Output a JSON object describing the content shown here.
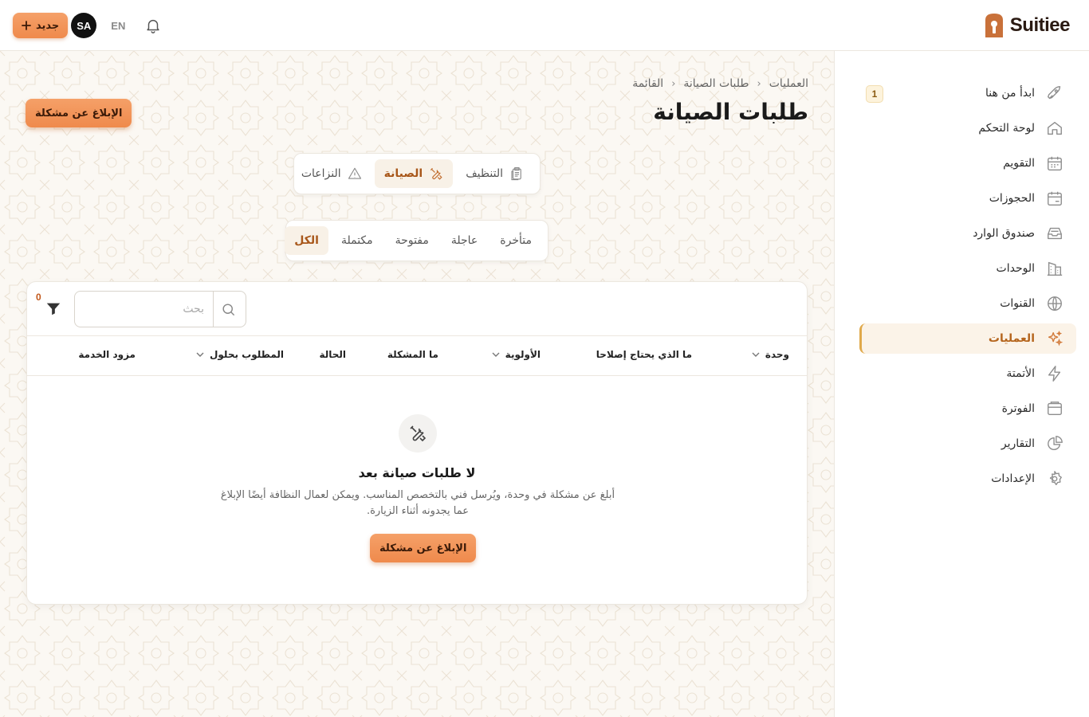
{
  "brand": {
    "name": "Suitiee"
  },
  "topbar": {
    "new_label": "جديد",
    "new_icon": "plus-icon",
    "avatar_initials": "SA",
    "language": "EN",
    "notifications_icon": "bell-icon"
  },
  "sidebar": {
    "items": [
      {
        "label": "ابدأ من هنا",
        "icon": "rocket-icon",
        "badge": "1"
      },
      {
        "label": "لوحة التحكم",
        "icon": "home-icon"
      },
      {
        "label": "التقويم",
        "icon": "calendar-icon"
      },
      {
        "label": "الحجوزات",
        "icon": "bookings-icon"
      },
      {
        "label": "صندوق الوارد",
        "icon": "inbox-icon"
      },
      {
        "label": "الوحدات",
        "icon": "building-icon"
      },
      {
        "label": "القنوات",
        "icon": "globe-icon"
      },
      {
        "label": "العمليات",
        "icon": "sparkles-icon",
        "active": true
      },
      {
        "label": "الأتمتة",
        "icon": "bolt-icon"
      },
      {
        "label": "الفوترة",
        "icon": "wallet-icon"
      },
      {
        "label": "التقارير",
        "icon": "pie-chart-icon"
      },
      {
        "label": "الإعدادات",
        "icon": "gear-icon"
      }
    ]
  },
  "breadcrumb": [
    "العمليات",
    "طلبات الصيانة",
    "القائمة"
  ],
  "page": {
    "title": "طلبات الصيانة",
    "report_button": "الإبلاغ عن مشكلة"
  },
  "type_tabs": [
    {
      "label": "التنظيف",
      "icon": "clipboard-icon"
    },
    {
      "label": "الصيانة",
      "icon": "tools-icon",
      "active": true
    },
    {
      "label": "النزاعات",
      "icon": "warning-icon"
    }
  ],
  "status_tabs": [
    {
      "label": "متأخرة"
    },
    {
      "label": "عاجلة"
    },
    {
      "label": "مفتوحة"
    },
    {
      "label": "مكتملة"
    },
    {
      "label": "الكل",
      "active": true
    }
  ],
  "table": {
    "search_placeholder": "بحث",
    "filter_count": "0",
    "columns": [
      "وحدة",
      "ما الذي يحتاج إصلاحا",
      "الأولوية",
      "ما المشكلة",
      "الحالة",
      "المطلوب بحلول",
      "مزود الخدمة"
    ],
    "empty": {
      "title": "لا طلبات صيانة بعد",
      "description": "أبلغ عن مشكلة في وحدة، ويُرسل فني بالتخصص المناسب. ويمكن لعمال النظافة أيضًا الإبلاغ عما يجدونه أثناء الزيارة.",
      "button": "الإبلاغ عن مشكلة"
    }
  },
  "colors": {
    "accent": "#ef8a4c",
    "active_text": "#b5651d",
    "background": "#fbf8f3"
  }
}
